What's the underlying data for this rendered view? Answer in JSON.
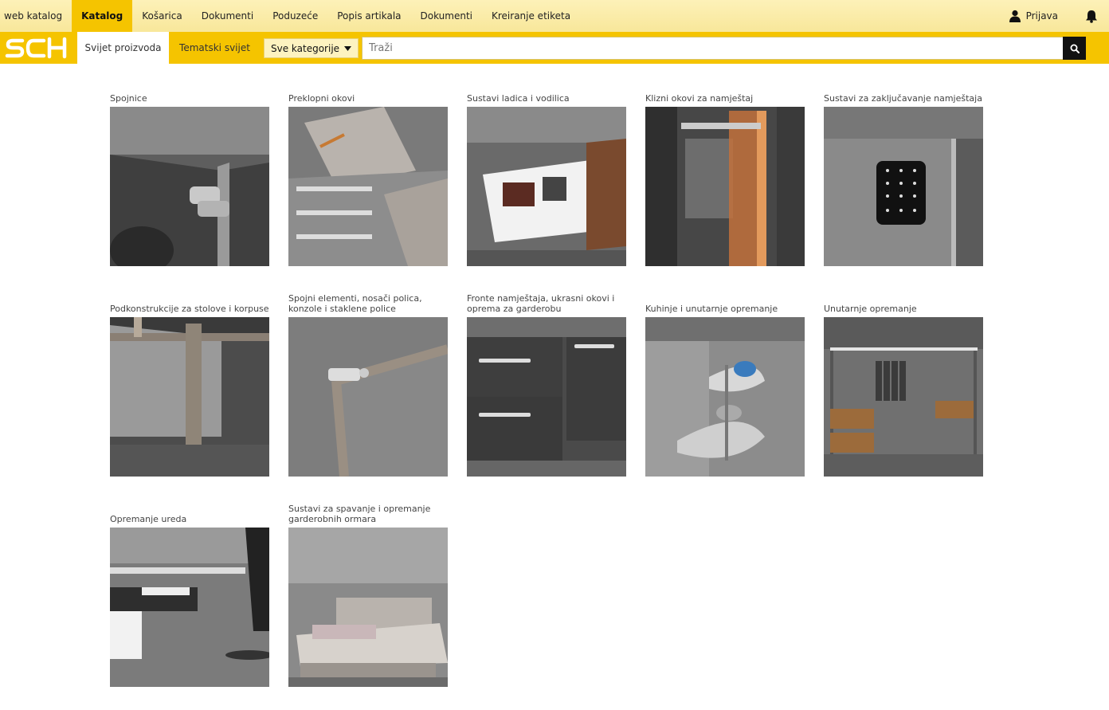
{
  "topnav": {
    "items": [
      "web katalog",
      "Katalog",
      "Košarica",
      "Dokumenti",
      "Poduzeće",
      "Popis artikala",
      "Dokumenti",
      "Kreiranje etiketa"
    ],
    "active_index": 1,
    "login_label": "Prijava"
  },
  "subnav": {
    "logo_text": "SCH",
    "tabs": [
      "Svijet proizvoda",
      "Tematski svijet"
    ],
    "active_tab": 0,
    "category_dropdown": "Sve kategorije",
    "search_placeholder": "Traži"
  },
  "colors": {
    "brand_yellow": "#f5c400",
    "top_bar": "#f8e79a"
  },
  "categories": [
    {
      "label": "Spojnice",
      "icon": "hinge"
    },
    {
      "label": "Preklopni okovi",
      "icon": "lift-up-fitting"
    },
    {
      "label": "Sustavi ladica i vodilica",
      "icon": "drawer"
    },
    {
      "label": "Klizni okovi za namještaj",
      "icon": "sliding-door"
    },
    {
      "label": "Sustavi za zaključavanje namještaja",
      "icon": "keypad-lock"
    },
    {
      "label": "Podkonstrukcije za stolove i korpuse",
      "icon": "table-leg"
    },
    {
      "label": "Spojni elementi, nosači polica, konzole i staklene police",
      "icon": "connector"
    },
    {
      "label": "Fronte namještaja, ukrasni okovi i oprema za garderobu",
      "icon": "handles"
    },
    {
      "label": "Kuhinje i unutarnje opremanje",
      "icon": "corner-carousel"
    },
    {
      "label": "Unutarnje opremanje",
      "icon": "wardrobe"
    },
    {
      "label": "Opremanje ureda",
      "icon": "office"
    },
    {
      "label": "Sustavi za spavanje i opremanje garderobnih ormara",
      "icon": "bed"
    }
  ]
}
